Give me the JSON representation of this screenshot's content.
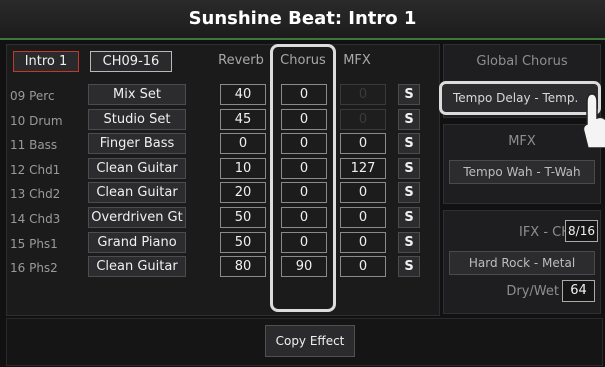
{
  "window": {
    "title": "Sunshine Beat: Intro 1"
  },
  "header": {
    "intro_button": "Intro 1",
    "channel_button": "CH09-16",
    "col_reverb": "Reverb",
    "col_chorus": "Chorus",
    "col_mfx": "MFX"
  },
  "rows": [
    {
      "part": "09 Perc",
      "effect": "Mix Set",
      "reverb": "40",
      "chorus": "0",
      "mfx": "0",
      "s": "S"
    },
    {
      "part": "10 Drum",
      "effect": "Studio Set",
      "reverb": "45",
      "chorus": "0",
      "mfx": "0",
      "s": "S"
    },
    {
      "part": "11 Bass",
      "effect": "Finger Bass",
      "reverb": "0",
      "chorus": "0",
      "mfx": "0",
      "s": "S"
    },
    {
      "part": "12 Chd1",
      "effect": "Clean Guitar",
      "reverb": "10",
      "chorus": "0",
      "mfx": "127",
      "s": "S"
    },
    {
      "part": "13 Chd2",
      "effect": "Clean Guitar",
      "reverb": "20",
      "chorus": "0",
      "mfx": "0",
      "s": "S"
    },
    {
      "part": "14 Chd3",
      "effect": "Overdriven Gt",
      "reverb": "50",
      "chorus": "0",
      "mfx": "0",
      "s": "S"
    },
    {
      "part": "15 Phs1",
      "effect": "Grand Piano",
      "reverb": "50",
      "chorus": "0",
      "mfx": "0",
      "s": "S"
    },
    {
      "part": "16 Phs2",
      "effect": "Clean Guitar",
      "reverb": "80",
      "chorus": "90",
      "mfx": "0",
      "s": "S"
    }
  ],
  "right_panel": {
    "global_chorus_label": "Global Chorus",
    "global_chorus_value": "Tempo Delay - Temp.",
    "mfx_label": "MFX",
    "mfx_value": "Tempo Wah - T-Wah",
    "ifx_label": "IFX - CH",
    "ifx_value": "8/16",
    "ifx_type": "Hard Rock - Metal",
    "drywet_label": "Dry/Wet",
    "drywet_value": "64"
  },
  "footer": {
    "copy_button": "Copy Effect"
  },
  "colors": {
    "highlight": "#e8e8e8",
    "accent_red": "#c0392b",
    "title_underline": "#3c7a3c"
  },
  "icons": {
    "pointer": "hand-pointer-icon"
  }
}
